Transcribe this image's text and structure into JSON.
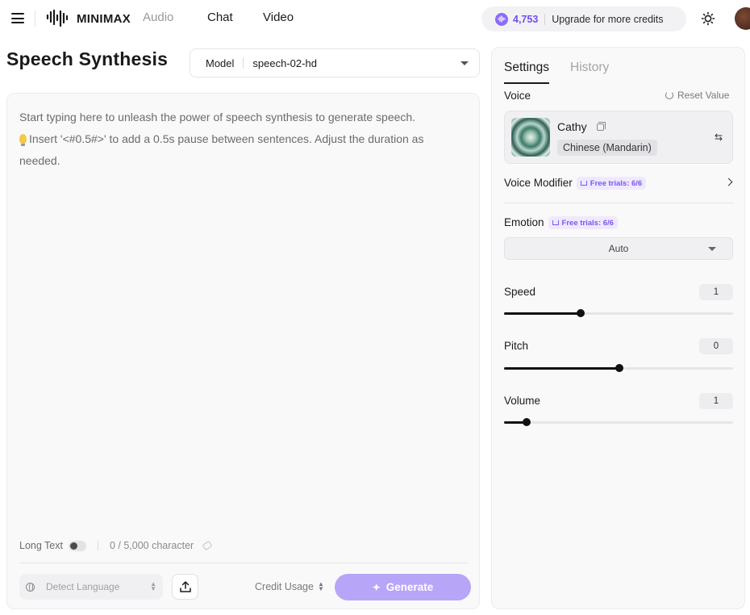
{
  "topbar": {
    "brand": "MINIMAX",
    "nav": {
      "audio": "Audio",
      "chat": "Chat",
      "video": "Video"
    },
    "credits": {
      "count": "4,753",
      "cta": "Upgrade for more credits"
    }
  },
  "title": "Speech Synthesis",
  "model": {
    "label": "Model",
    "value": "speech-02-hd"
  },
  "editor": {
    "placeholder_line1": "Start typing here to unleash the power of speech synthesis to generate speech.",
    "placeholder_line2": "Insert '<#0.5#>' to add a 0.5s pause between sentences. Adjust the duration as needed.",
    "long_text_label": "Long Text",
    "char_count": "0 / 5,000 character",
    "language_placeholder": "Detect Language",
    "credit_usage_label": "Credit Usage",
    "generate_label": "Generate"
  },
  "panel": {
    "tabs": {
      "settings": "Settings",
      "history": "History"
    },
    "voice": {
      "label": "Voice",
      "reset_label": "Reset Value",
      "name": "Cathy",
      "language_tag": "Chinese (Mandarin)"
    },
    "voice_modifier": {
      "label": "Voice Modifier",
      "badge": "Free trials: 6/6"
    },
    "emotion": {
      "label": "Emotion",
      "badge": "Free trials: 6/6",
      "value": "Auto"
    },
    "speed": {
      "label": "Speed",
      "value": "1",
      "fill_percent": 33.5
    },
    "pitch": {
      "label": "Pitch",
      "value": "0",
      "fill_percent": 50.5
    },
    "volume": {
      "label": "Volume",
      "value": "1",
      "fill_percent": 10
    }
  },
  "colors": {
    "accent": "#6f4df0",
    "generate_bg": "#b7a5f7",
    "badge_bg": "#efe9fe"
  }
}
